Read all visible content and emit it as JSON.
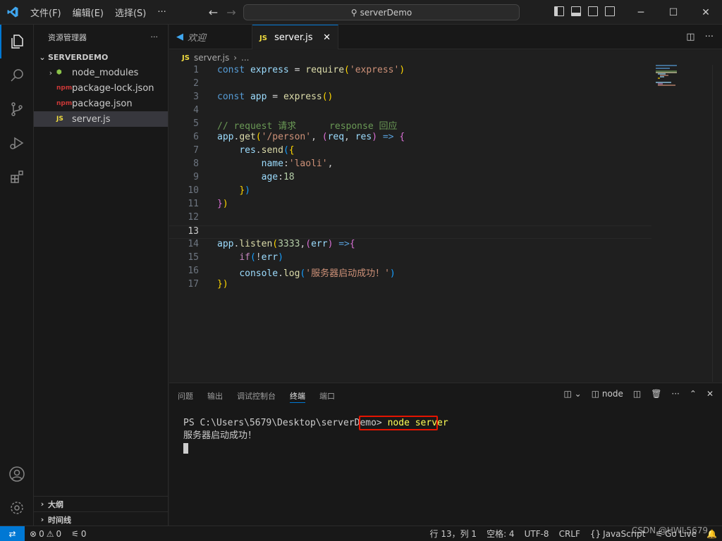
{
  "titlebar": {
    "menu": [
      "文件(F)",
      "编辑(E)",
      "选择(S)",
      "···"
    ],
    "command_center": "serverDemo",
    "nav_back": "←",
    "nav_forward": "→"
  },
  "sidebar": {
    "title": "资源管理器",
    "more": "···",
    "project": "SERVERDEMO",
    "items": [
      {
        "label": "node_modules",
        "type": "folder"
      },
      {
        "label": "package-lock.json",
        "type": "json"
      },
      {
        "label": "package.json",
        "type": "json"
      },
      {
        "label": "server.js",
        "type": "js"
      }
    ],
    "outline": "大纲",
    "timeline": "时间线"
  },
  "tabs": {
    "welcome": "欢迎",
    "active": "server.js",
    "js_badge": "JS"
  },
  "breadcrumb": {
    "file": "server.js",
    "more": "..."
  },
  "editor": {
    "current_line": 13,
    "lines": [
      "1",
      "2",
      "3",
      "4",
      "5",
      "6",
      "7",
      "8",
      "9",
      "10",
      "11",
      "12",
      "13",
      "14",
      "15",
      "16",
      "17"
    ]
  },
  "panel": {
    "tabs": [
      "问题",
      "输出",
      "调试控制台",
      "终端",
      "端口"
    ],
    "active_tab": "终端",
    "terminal_name": "node",
    "prompt": "PS C:\\Users\\5679\\Desktop\\serverDemo>",
    "command": "node server",
    "output": "服务器启动成功！"
  },
  "statusbar": {
    "errors": "0",
    "warnings": "0",
    "ports": "0",
    "position": "行 13，列 1",
    "spaces": "空格: 4",
    "encoding": "UTF-8",
    "eol": "CRLF",
    "language": "JavaScript",
    "golive": "Go Live",
    "watermark": "CSDN @HWL5679"
  },
  "colors": {
    "accent": "#0078d4",
    "highlight_box": "#e51400"
  }
}
